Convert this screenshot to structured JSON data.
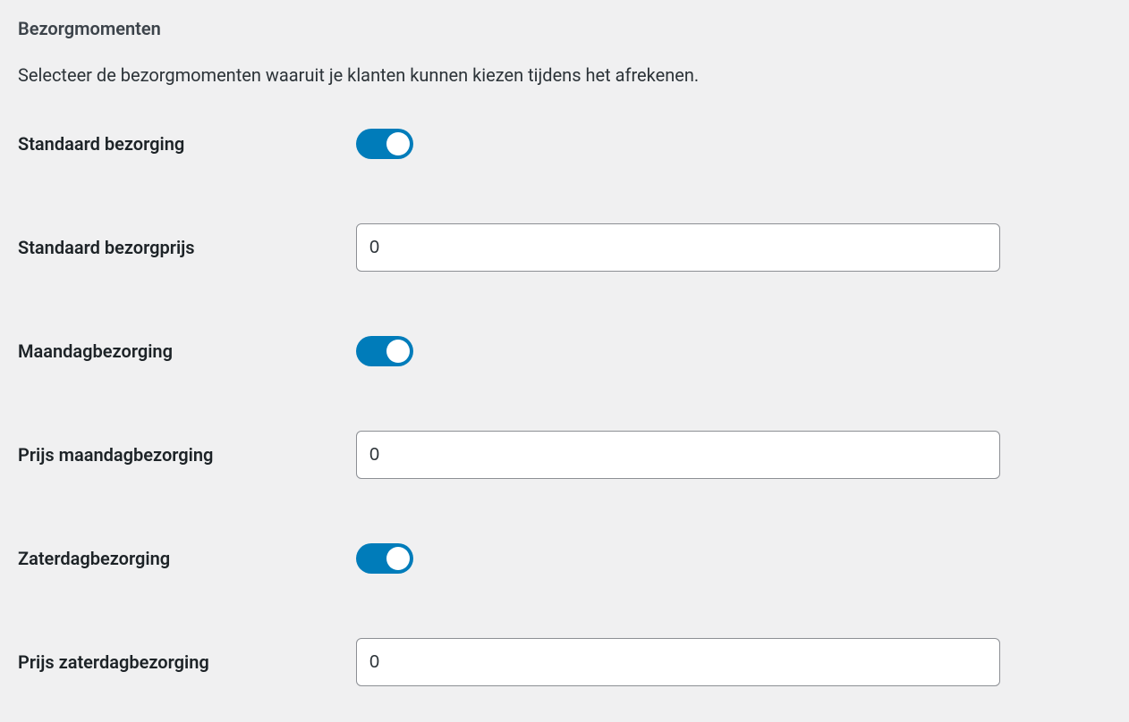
{
  "section": {
    "title": "Bezorgmomenten",
    "description": "Selecteer de bezorgmomenten waaruit je klanten kunnen kiezen tijdens het afrekenen."
  },
  "fields": {
    "standard_delivery": {
      "label": "Standaard bezorging",
      "enabled": true
    },
    "standard_price": {
      "label": "Standaard bezorgprijs",
      "value": "0"
    },
    "monday_delivery": {
      "label": "Maandagbezorging",
      "enabled": true
    },
    "monday_price": {
      "label": "Prijs maandagbezorging",
      "value": "0"
    },
    "saturday_delivery": {
      "label": "Zaterdagbezorging",
      "enabled": true
    },
    "saturday_price": {
      "label": "Prijs zaterdagbezorging",
      "value": "0"
    }
  }
}
